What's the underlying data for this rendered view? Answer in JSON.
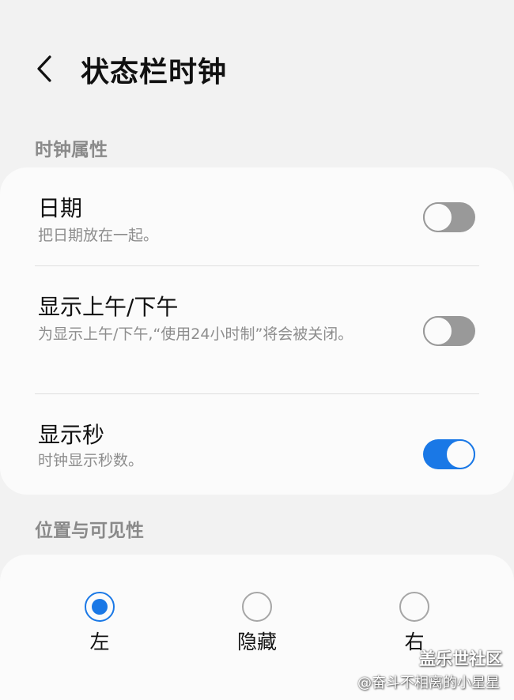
{
  "header": {
    "title": "状态栏时钟",
    "back_icon": "chevron-left-icon"
  },
  "clock_section": {
    "label": "时钟属性",
    "items": [
      {
        "title": "日期",
        "description": "把日期放在一起。",
        "enabled": false
      },
      {
        "title": "显示上午/下午",
        "description": "为显示上午/下午,“使用24小时制”将会被关闭。",
        "enabled": false
      },
      {
        "title": "显示秒",
        "description": "时钟显示秒数。",
        "enabled": true
      }
    ]
  },
  "position_section": {
    "label": "位置与可见性",
    "options": [
      {
        "label": "左",
        "selected": true
      },
      {
        "label": "隐藏",
        "selected": false
      },
      {
        "label": "右",
        "selected": false
      }
    ]
  },
  "watermark": {
    "main": "盖乐世社区",
    "sub": "@奋斗不相离的小星星"
  },
  "colors": {
    "accent": "#1a78e6",
    "toggle_off": "#999999",
    "background": "#f2f2f2",
    "card": "#fbfbfb"
  }
}
